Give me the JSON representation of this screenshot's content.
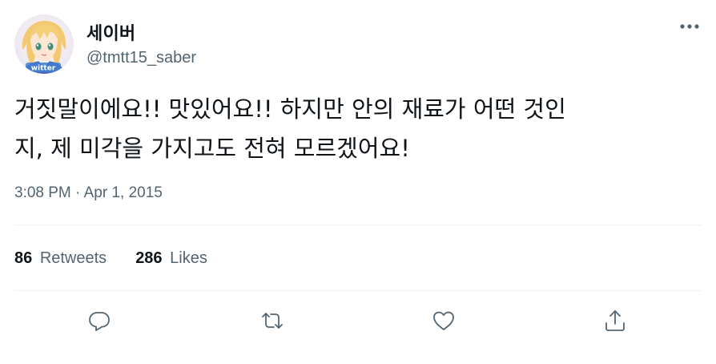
{
  "tweet": {
    "author": {
      "display_name": "세이버",
      "handle": "@tmtt15_saber",
      "avatar_caption": "witter"
    },
    "text_lines": [
      "거짓말이에요!! 맛있어요!! 하지만 안의 재료가 어떤 것인",
      "지, 제 미각을 가지고도 전혀 모르겠어요!"
    ],
    "timestamp": "3:08 PM · Apr 1, 2015",
    "stats": {
      "retweets_count": "86",
      "retweets_label": "Retweets",
      "likes_count": "286",
      "likes_label": "Likes"
    },
    "actions": {
      "reply_icon": "reply-icon",
      "retweet_icon": "retweet-icon",
      "like_icon": "heart-icon",
      "share_icon": "share-icon",
      "more_icon": "more-icon"
    },
    "colors": {
      "text_primary": "#0f1419",
      "text_secondary": "#536471",
      "divider": "#eff3f4"
    }
  }
}
